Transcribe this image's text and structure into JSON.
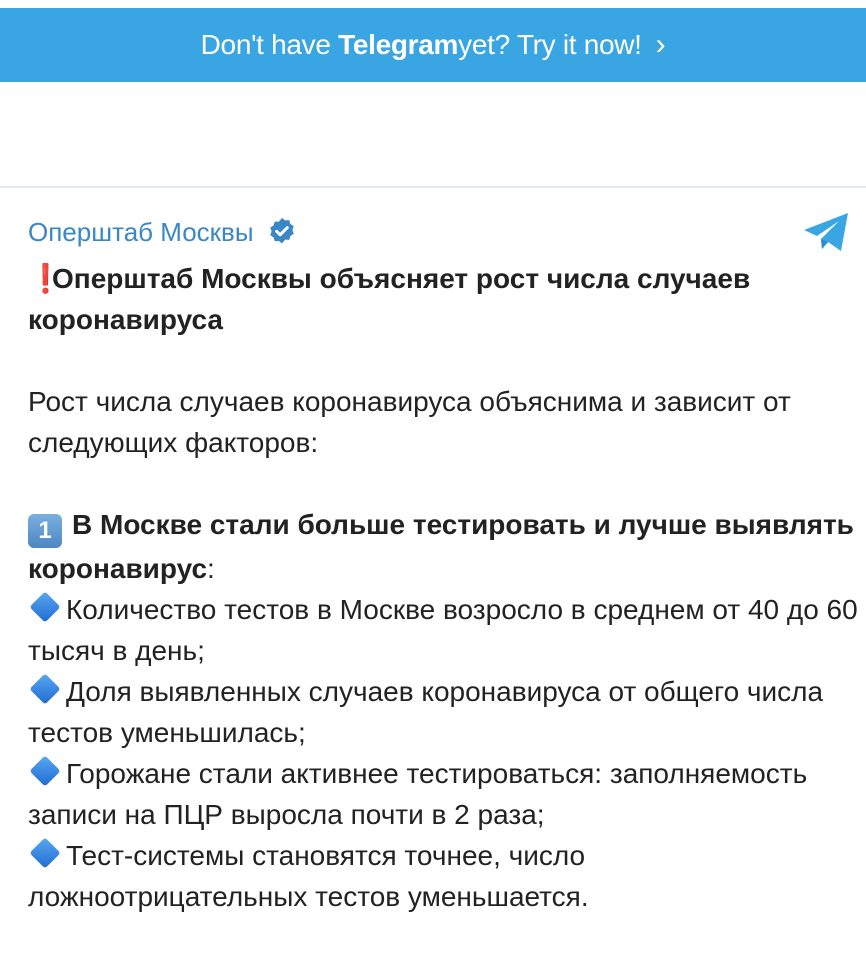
{
  "banner": {
    "prefix": "Don't have ",
    "brand": "Telegram",
    "suffix": " yet? Try it now!",
    "chevron": "›",
    "bg_color": "#3aa5e3"
  },
  "post": {
    "channel_name": "Оперштаб Москвы",
    "verified_icon": "verified-badge-icon",
    "logo_icon": "telegram-plane-icon",
    "title_icon": "❗",
    "title": "Оперштаб Москвы объясняет рост числа случаев коронавируса",
    "intro": "Рост числа случаев коронавируса объяснима и зависит от следующих факторов:",
    "section": {
      "number": "1",
      "heading": "В Москве стали больше тестировать и лучше выявлять коронавирус",
      "colon": ":",
      "bullets": [
        "Количество тестов в Москве возросло в среднем от 40 до 60 тысяч в день;",
        "Доля выявленных случаев коронавируса от общего числа тестов уменьшилась;",
        "Горожане стали активнее тестироваться: заполняемость записи на ПЦР выросла почти в 2 раза;",
        "Тест-системы становятся точнее, число ложноотрицательных тестов уменьшается."
      ]
    }
  },
  "colors": {
    "channel": "#3a87c8",
    "exclamation": "#e0242d"
  }
}
